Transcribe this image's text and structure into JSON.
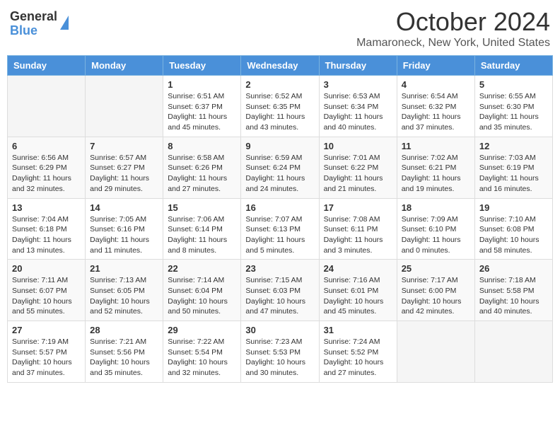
{
  "logo": {
    "general": "General",
    "blue": "Blue"
  },
  "header": {
    "month": "October 2024",
    "location": "Mamaroneck, New York, United States"
  },
  "weekdays": [
    "Sunday",
    "Monday",
    "Tuesday",
    "Wednesday",
    "Thursday",
    "Friday",
    "Saturday"
  ],
  "weeks": [
    [
      {
        "day": null,
        "info": null
      },
      {
        "day": null,
        "info": null
      },
      {
        "day": "1",
        "info": "Sunrise: 6:51 AM\nSunset: 6:37 PM\nDaylight: 11 hours and 45 minutes."
      },
      {
        "day": "2",
        "info": "Sunrise: 6:52 AM\nSunset: 6:35 PM\nDaylight: 11 hours and 43 minutes."
      },
      {
        "day": "3",
        "info": "Sunrise: 6:53 AM\nSunset: 6:34 PM\nDaylight: 11 hours and 40 minutes."
      },
      {
        "day": "4",
        "info": "Sunrise: 6:54 AM\nSunset: 6:32 PM\nDaylight: 11 hours and 37 minutes."
      },
      {
        "day": "5",
        "info": "Sunrise: 6:55 AM\nSunset: 6:30 PM\nDaylight: 11 hours and 35 minutes."
      }
    ],
    [
      {
        "day": "6",
        "info": "Sunrise: 6:56 AM\nSunset: 6:29 PM\nDaylight: 11 hours and 32 minutes."
      },
      {
        "day": "7",
        "info": "Sunrise: 6:57 AM\nSunset: 6:27 PM\nDaylight: 11 hours and 29 minutes."
      },
      {
        "day": "8",
        "info": "Sunrise: 6:58 AM\nSunset: 6:26 PM\nDaylight: 11 hours and 27 minutes."
      },
      {
        "day": "9",
        "info": "Sunrise: 6:59 AM\nSunset: 6:24 PM\nDaylight: 11 hours and 24 minutes."
      },
      {
        "day": "10",
        "info": "Sunrise: 7:01 AM\nSunset: 6:22 PM\nDaylight: 11 hours and 21 minutes."
      },
      {
        "day": "11",
        "info": "Sunrise: 7:02 AM\nSunset: 6:21 PM\nDaylight: 11 hours and 19 minutes."
      },
      {
        "day": "12",
        "info": "Sunrise: 7:03 AM\nSunset: 6:19 PM\nDaylight: 11 hours and 16 minutes."
      }
    ],
    [
      {
        "day": "13",
        "info": "Sunrise: 7:04 AM\nSunset: 6:18 PM\nDaylight: 11 hours and 13 minutes."
      },
      {
        "day": "14",
        "info": "Sunrise: 7:05 AM\nSunset: 6:16 PM\nDaylight: 11 hours and 11 minutes."
      },
      {
        "day": "15",
        "info": "Sunrise: 7:06 AM\nSunset: 6:14 PM\nDaylight: 11 hours and 8 minutes."
      },
      {
        "day": "16",
        "info": "Sunrise: 7:07 AM\nSunset: 6:13 PM\nDaylight: 11 hours and 5 minutes."
      },
      {
        "day": "17",
        "info": "Sunrise: 7:08 AM\nSunset: 6:11 PM\nDaylight: 11 hours and 3 minutes."
      },
      {
        "day": "18",
        "info": "Sunrise: 7:09 AM\nSunset: 6:10 PM\nDaylight: 11 hours and 0 minutes."
      },
      {
        "day": "19",
        "info": "Sunrise: 7:10 AM\nSunset: 6:08 PM\nDaylight: 10 hours and 58 minutes."
      }
    ],
    [
      {
        "day": "20",
        "info": "Sunrise: 7:11 AM\nSunset: 6:07 PM\nDaylight: 10 hours and 55 minutes."
      },
      {
        "day": "21",
        "info": "Sunrise: 7:13 AM\nSunset: 6:05 PM\nDaylight: 10 hours and 52 minutes."
      },
      {
        "day": "22",
        "info": "Sunrise: 7:14 AM\nSunset: 6:04 PM\nDaylight: 10 hours and 50 minutes."
      },
      {
        "day": "23",
        "info": "Sunrise: 7:15 AM\nSunset: 6:03 PM\nDaylight: 10 hours and 47 minutes."
      },
      {
        "day": "24",
        "info": "Sunrise: 7:16 AM\nSunset: 6:01 PM\nDaylight: 10 hours and 45 minutes."
      },
      {
        "day": "25",
        "info": "Sunrise: 7:17 AM\nSunset: 6:00 PM\nDaylight: 10 hours and 42 minutes."
      },
      {
        "day": "26",
        "info": "Sunrise: 7:18 AM\nSunset: 5:58 PM\nDaylight: 10 hours and 40 minutes."
      }
    ],
    [
      {
        "day": "27",
        "info": "Sunrise: 7:19 AM\nSunset: 5:57 PM\nDaylight: 10 hours and 37 minutes."
      },
      {
        "day": "28",
        "info": "Sunrise: 7:21 AM\nSunset: 5:56 PM\nDaylight: 10 hours and 35 minutes."
      },
      {
        "day": "29",
        "info": "Sunrise: 7:22 AM\nSunset: 5:54 PM\nDaylight: 10 hours and 32 minutes."
      },
      {
        "day": "30",
        "info": "Sunrise: 7:23 AM\nSunset: 5:53 PM\nDaylight: 10 hours and 30 minutes."
      },
      {
        "day": "31",
        "info": "Sunrise: 7:24 AM\nSunset: 5:52 PM\nDaylight: 10 hours and 27 minutes."
      },
      {
        "day": null,
        "info": null
      },
      {
        "day": null,
        "info": null
      }
    ]
  ]
}
